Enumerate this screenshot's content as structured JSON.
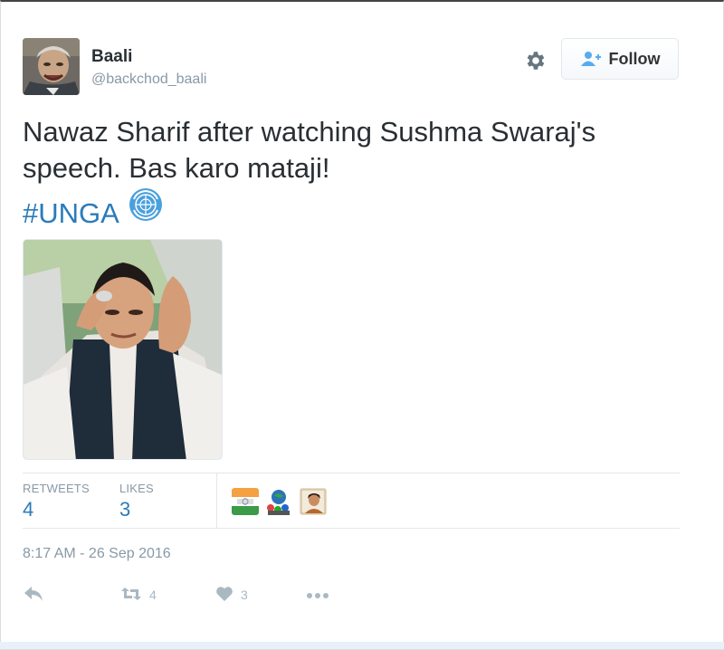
{
  "author": {
    "name": "Baali",
    "handle": "@backchod_baali"
  },
  "header": {
    "follow_label": "Follow",
    "settings_icon": "gear-icon",
    "follow_icon": "add-user-icon"
  },
  "tweet": {
    "line1": "Nawaz Sharif after watching Sushma Swaraj's",
    "line2": "speech. Bas karo mataji!",
    "hashtag": "#UNGA",
    "hashtag_emoji": "un-flag-emoji"
  },
  "stats": {
    "retweets_label": "RETWEETS",
    "retweets_value": "4",
    "likes_label": "LIKES",
    "likes_value": "3"
  },
  "timestamp": "8:17 AM - 26 Sep 2016",
  "actions": {
    "reply_icon": "reply-icon",
    "retweet_icon": "retweet-icon",
    "retweet_count": "4",
    "like_icon": "heart-icon",
    "like_count": "3",
    "more_icon": "more-icon"
  },
  "colors": {
    "link": "#2b7bb9",
    "muted": "#8899a6",
    "text": "#292f33",
    "icon": "#aab8c2"
  }
}
